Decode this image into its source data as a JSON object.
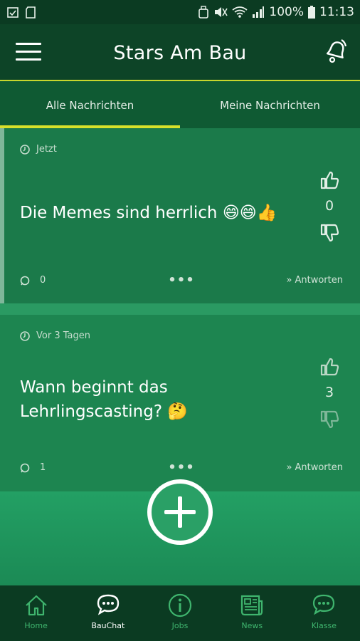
{
  "status_bar": {
    "battery": "100%",
    "time": "11:13"
  },
  "app": {
    "title": "Stars Am Bau"
  },
  "tabs": [
    {
      "label": "Alle Nachrichten",
      "active": true
    },
    {
      "label": "Meine Nachrichten",
      "active": false
    }
  ],
  "posts": [
    {
      "time": "Jetzt",
      "text": "Die Memes sind herrlich 😄😄👍",
      "votes": "0",
      "comments": "0",
      "reply_label": "Antworten",
      "more": "•••"
    },
    {
      "time": "Vor 3 Tagen",
      "text": "Wann beginnt das Lehrlingscasting? 🤔",
      "votes": "3",
      "comments": "1",
      "reply_label": "Antworten",
      "more": "•••"
    }
  ],
  "bottom_nav": [
    {
      "label": "Home",
      "icon": "home-icon",
      "active": false
    },
    {
      "label": "BauChat",
      "icon": "chat-icon",
      "active": true
    },
    {
      "label": "Jobs",
      "icon": "info-icon",
      "active": false
    },
    {
      "label": "News",
      "icon": "newspaper-icon",
      "active": false
    },
    {
      "label": "Klasse",
      "icon": "class-chat-icon",
      "active": false
    }
  ],
  "colors": {
    "accent": "#d8e02a",
    "primary_dark": "#0b3b22",
    "card": "#1b7a4a",
    "nav_icon": "#3fb56e"
  }
}
